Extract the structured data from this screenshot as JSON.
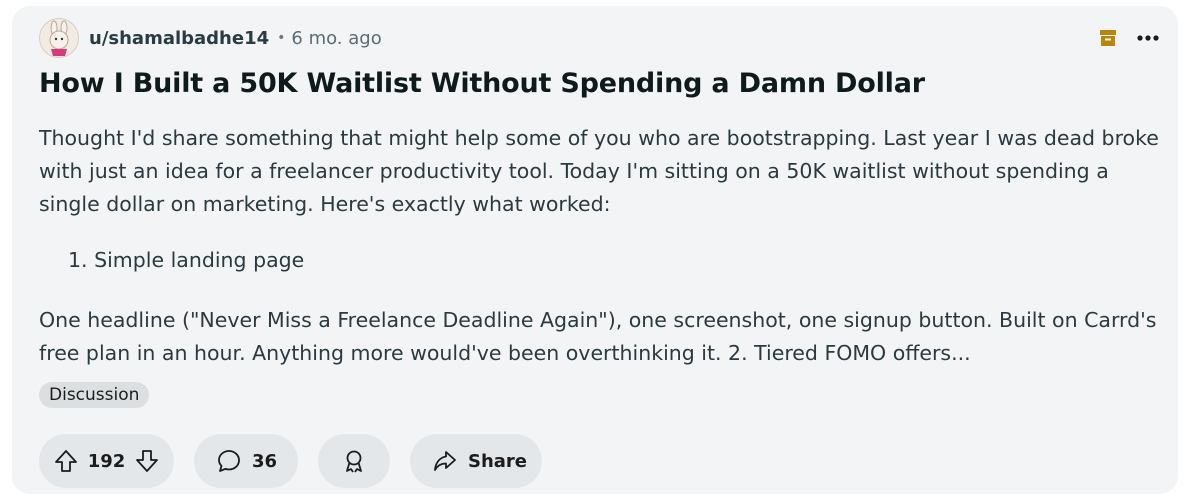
{
  "post": {
    "username": "u/shamalbadhe14",
    "separator": "•",
    "time_ago": "6 mo. ago",
    "title": "How I Built a 50K Waitlist Without Spending a Damn Dollar",
    "body_intro": "Thought I'd share something that might help some of you who are bootstrapping. Last year I was dead broke with just an idea for a freelancer productivity tool. Today I'm sitting on a 50K waitlist without spending a single dollar on marketing. Here's exactly what worked:",
    "list_item_1": "1. Simple landing page",
    "body_cont": "One headline (\"Never Miss a Freelance Deadline Again\"), one screenshot, one signup button. Built on Carrd's free plan in an hour. Anything more would've been overthinking it. 2. Tiered FOMO offers...",
    "flair": "Discussion"
  },
  "actions": {
    "upvote_count": "192",
    "comment_count": "36",
    "share_label": "Share"
  },
  "icons": {
    "archive": "archive-icon",
    "more": "more-options-icon",
    "upvote": "upvote-arrow-icon",
    "downvote": "downvote-arrow-icon",
    "comment": "comment-bubble-icon",
    "award": "award-icon",
    "share": "share-arrow-icon"
  },
  "colors": {
    "card_bg": "#f3f4f5",
    "archive_icon": "#b8860b",
    "pill_bg": "#e4e7e9",
    "flair_bg": "#dcdfe1"
  }
}
